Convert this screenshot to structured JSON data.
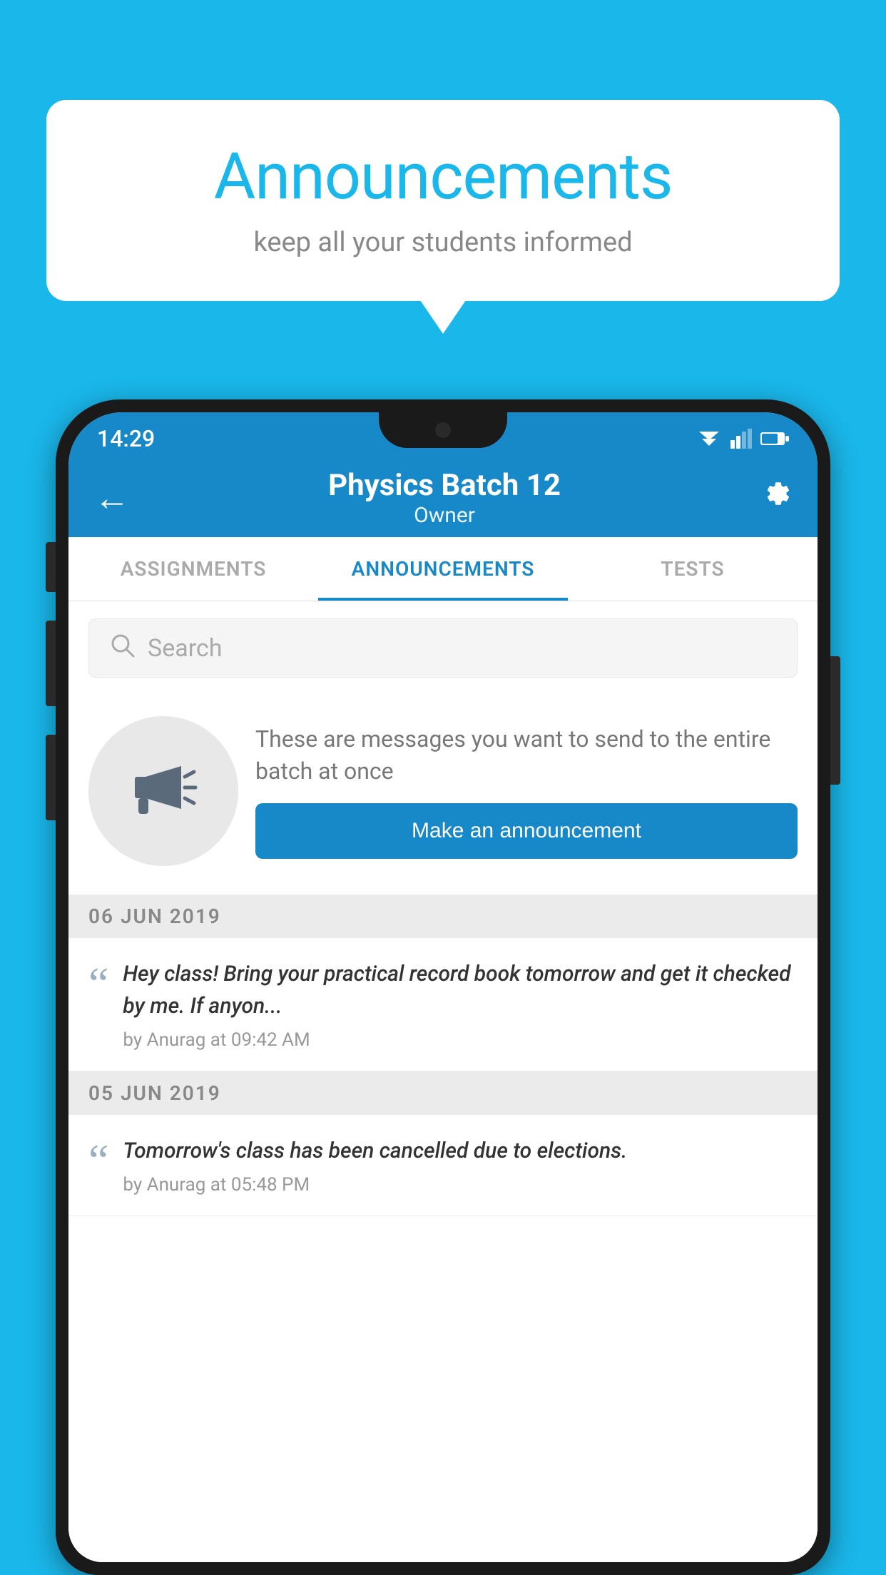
{
  "bubble": {
    "title": "Announcements",
    "subtitle": "keep all your students informed"
  },
  "statusBar": {
    "time": "14:29"
  },
  "appBar": {
    "title": "Physics Batch 12",
    "subtitle": "Owner"
  },
  "tabs": [
    {
      "label": "ASSIGNMENTS",
      "active": false
    },
    {
      "label": "ANNOUNCEMENTS",
      "active": true
    },
    {
      "label": "TESTS",
      "active": false
    },
    {
      "label": "...",
      "active": false
    }
  ],
  "search": {
    "placeholder": "Search"
  },
  "promo": {
    "text": "These are messages you want to send to the entire batch at once",
    "button": "Make an announcement"
  },
  "announcements": [
    {
      "date": "06  JUN  2019",
      "text": "Hey class! Bring your practical record book tomorrow and get it checked by me. If anyon...",
      "meta": "by Anurag at 09:42 AM"
    },
    {
      "date": "05  JUN  2019",
      "text": "Tomorrow's class has been cancelled due to elections.",
      "meta": "by Anurag at 05:48 PM"
    }
  ]
}
